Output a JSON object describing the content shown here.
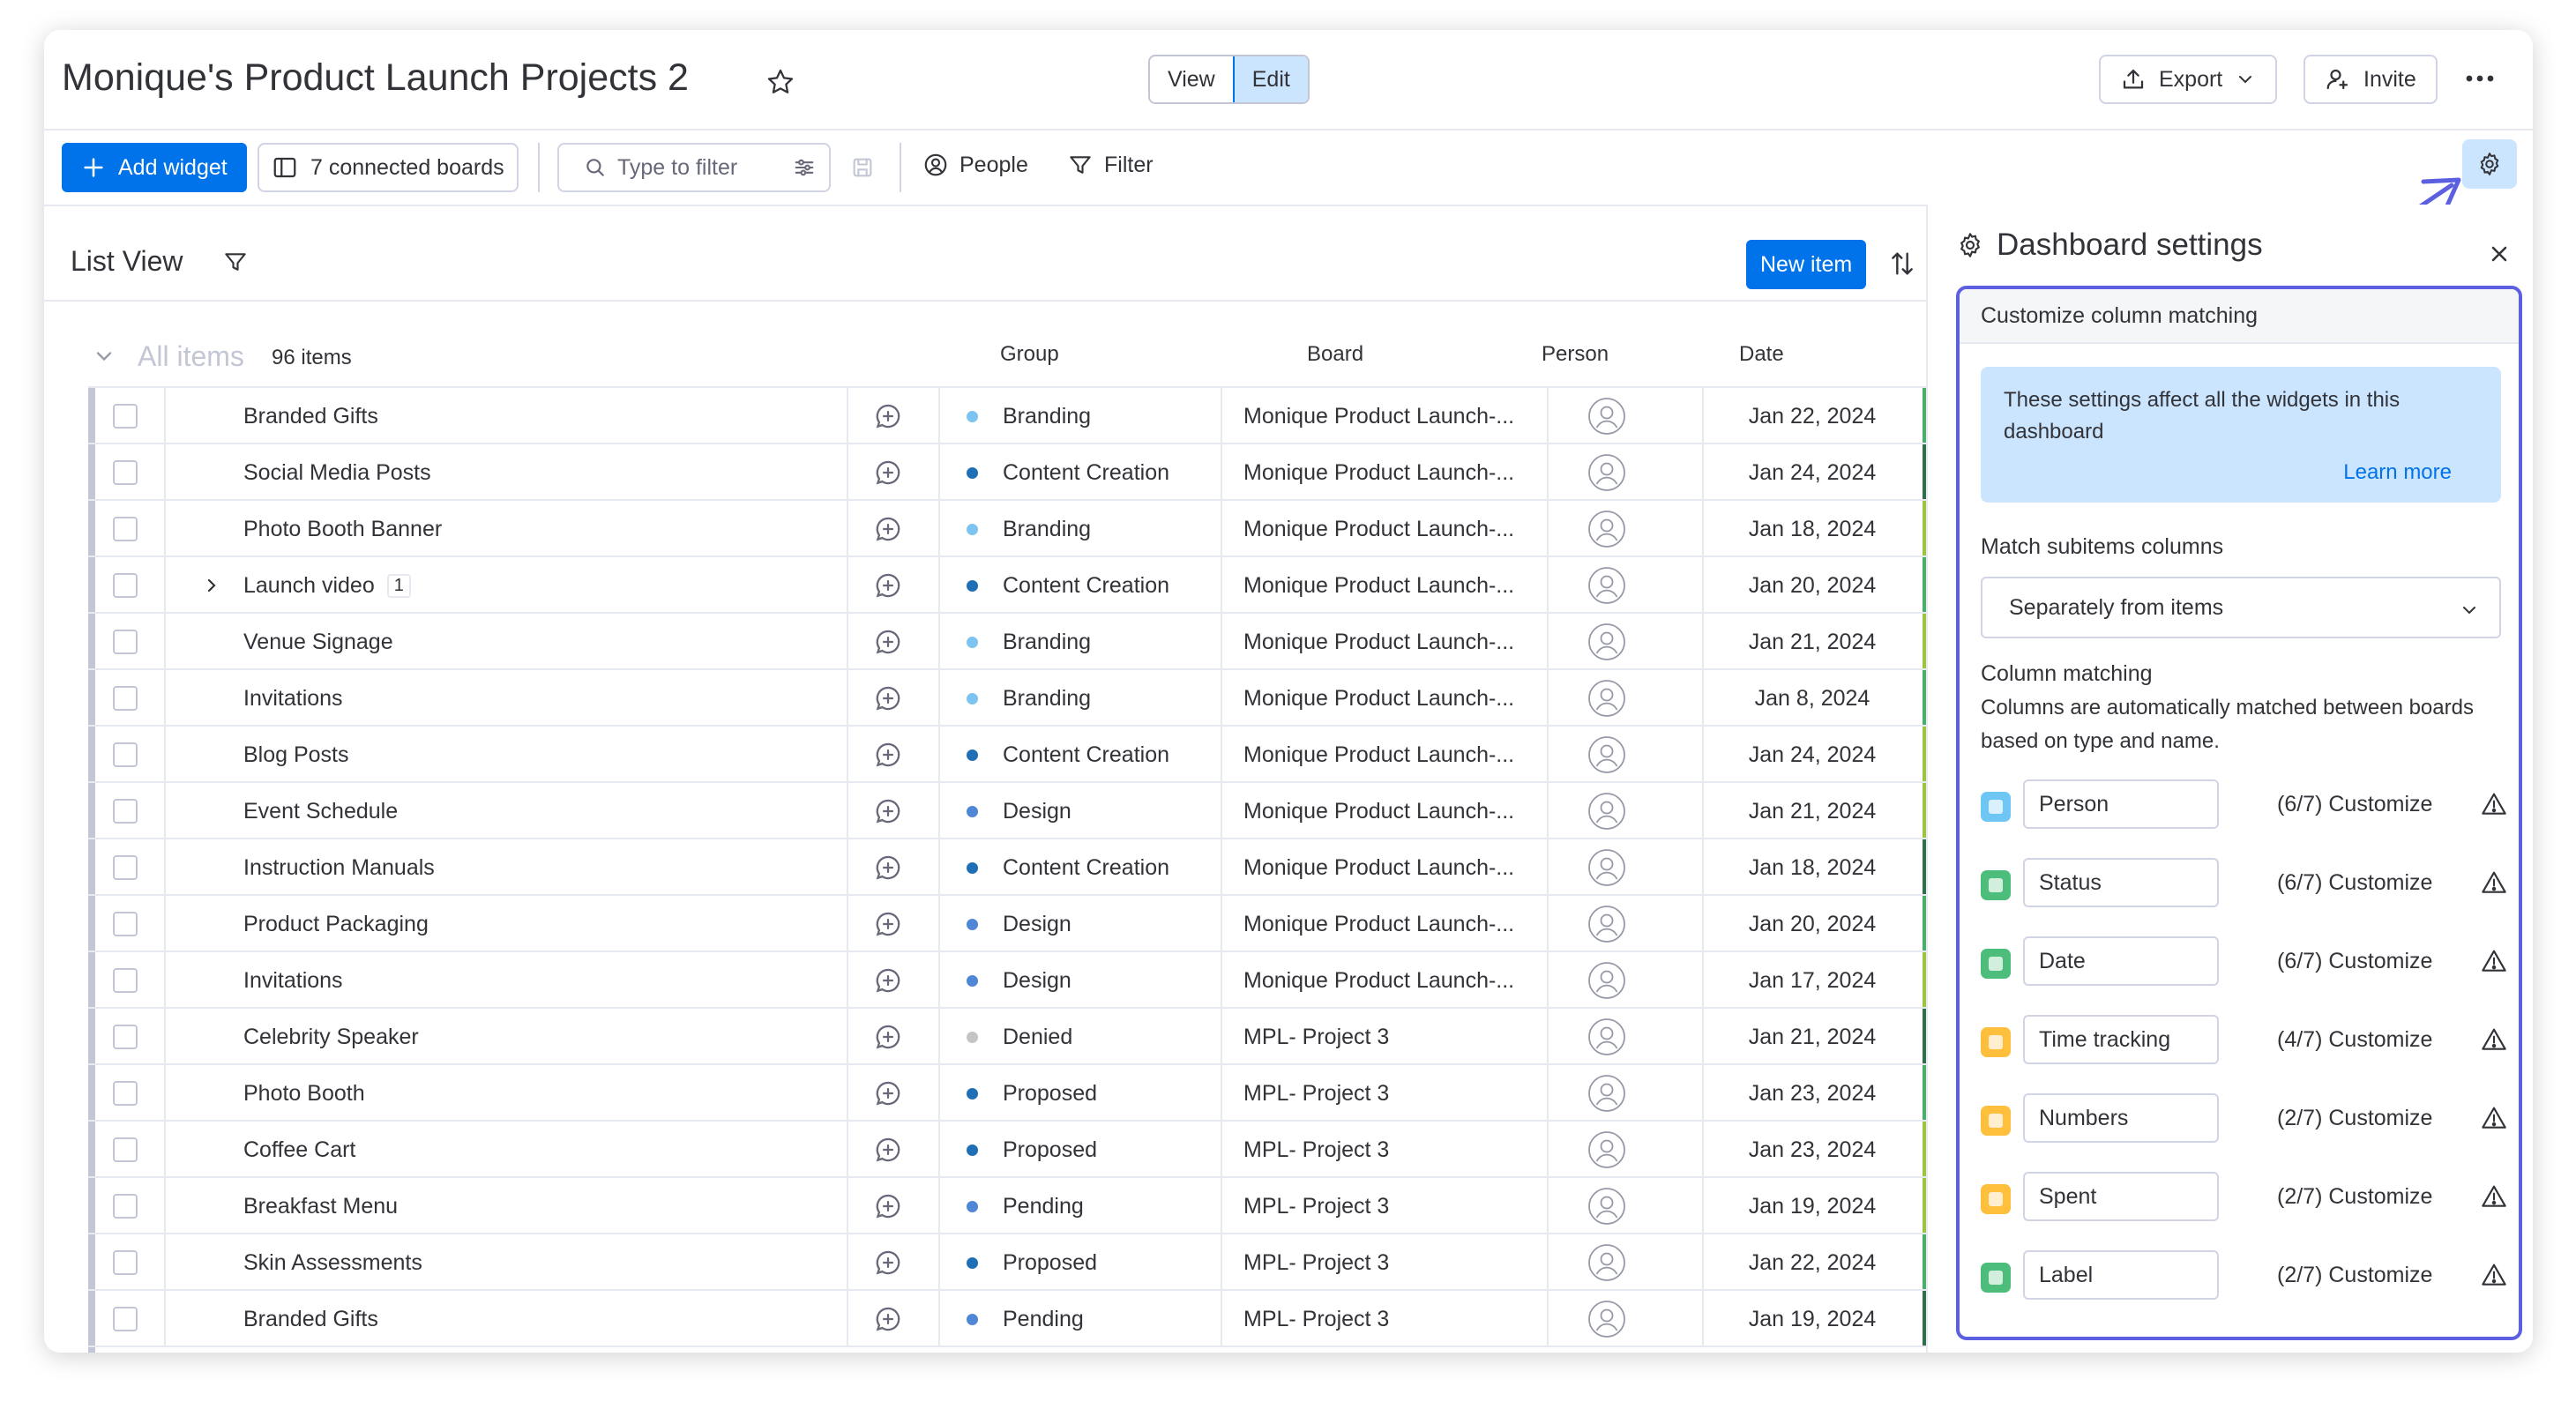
{
  "header": {
    "title": "Monique's Product Launch Projects 2",
    "view_label": "View",
    "edit_label": "Edit",
    "export_label": "Export",
    "invite_label": "Invite"
  },
  "toolbar": {
    "add_widget": "Add widget",
    "connected_boards": "7 connected boards",
    "filter_placeholder": "Type to filter",
    "people": "People",
    "filter": "Filter"
  },
  "list": {
    "title": "List View",
    "new_item": "New item",
    "group_title": "All items",
    "group_count": "96 items",
    "columns": [
      "Group",
      "Board",
      "Person",
      "Date"
    ],
    "rows": [
      {
        "name": "Branded Gifts",
        "group": "Branding",
        "dot": "#7dc4f0",
        "board": "Monique Product Launch-...",
        "date": "Jan 22, 2024",
        "strip": "#4cae6b"
      },
      {
        "name": "Social Media Posts",
        "group": "Content Creation",
        "dot": "#1f6fb5",
        "board": "Monique Product Launch-...",
        "date": "Jan 24, 2024",
        "strip": "#2f6f49"
      },
      {
        "name": "Photo Booth Banner",
        "group": "Branding",
        "dot": "#7dc4f0",
        "board": "Monique Product Launch-...",
        "date": "Jan 18, 2024",
        "strip": "#9cc43f"
      },
      {
        "name": "Launch video",
        "sub_count": "1",
        "expandable": true,
        "group": "Content Creation",
        "dot": "#1f6fb5",
        "board": "Monique Product Launch-...",
        "date": "Jan 20, 2024",
        "strip": "#4cae6b"
      },
      {
        "name": "Venue Signage",
        "group": "Branding",
        "dot": "#7dc4f0",
        "board": "Monique Product Launch-...",
        "date": "Jan 21, 2024",
        "strip": "#9cc43f"
      },
      {
        "name": "Invitations",
        "group": "Branding",
        "dot": "#7dc4f0",
        "board": "Monique Product Launch-...",
        "date": "Jan 8, 2024",
        "strip": "#4cae6b"
      },
      {
        "name": "Blog Posts",
        "group": "Content Creation",
        "dot": "#1f6fb5",
        "board": "Monique Product Launch-...",
        "date": "Jan 24, 2024",
        "strip": "#9cc43f"
      },
      {
        "name": "Event Schedule",
        "group": "Design",
        "dot": "#4f86d6",
        "board": "Monique Product Launch-...",
        "date": "Jan 21, 2024",
        "strip": "#9cc43f"
      },
      {
        "name": "Instruction Manuals",
        "group": "Content Creation",
        "dot": "#1f6fb5",
        "board": "Monique Product Launch-...",
        "date": "Jan 18, 2024",
        "strip": "#2f6f49"
      },
      {
        "name": "Product Packaging",
        "group": "Design",
        "dot": "#4f86d6",
        "board": "Monique Product Launch-...",
        "date": "Jan 20, 2024",
        "strip": "#4cae6b"
      },
      {
        "name": "Invitations",
        "group": "Design",
        "dot": "#4f86d6",
        "board": "Monique Product Launch-...",
        "date": "Jan 17, 2024",
        "strip": "#9cc43f"
      },
      {
        "name": "Celebrity Speaker",
        "group": "Denied",
        "dot": "#c4c4c4",
        "board": "MPL- Project 3",
        "date": "Jan 21, 2024",
        "strip": "#2f6f49"
      },
      {
        "name": "Photo Booth",
        "group": "Proposed",
        "dot": "#1f6fb5",
        "board": "MPL- Project 3",
        "date": "Jan 23, 2024",
        "strip": "#4cae6b"
      },
      {
        "name": "Coffee Cart",
        "group": "Proposed",
        "dot": "#1f6fb5",
        "board": "MPL- Project 3",
        "date": "Jan 23, 2024",
        "strip": "#9cc43f"
      },
      {
        "name": "Breakfast Menu",
        "group": "Pending",
        "dot": "#4f86d6",
        "board": "MPL- Project 3",
        "date": "Jan 19, 2024",
        "strip": "#9cc43f"
      },
      {
        "name": "Skin Assessments",
        "group": "Proposed",
        "dot": "#1f6fb5",
        "board": "MPL- Project 3",
        "date": "Jan 22, 2024",
        "strip": "#4cae6b"
      },
      {
        "name": "Branded Gifts",
        "group": "Pending",
        "dot": "#4f86d6",
        "board": "MPL- Project 3",
        "date": "Jan 19, 2024",
        "strip": "#2f6f49"
      }
    ]
  },
  "settings": {
    "title": "Dashboard settings",
    "section": "Customize column matching",
    "info_text": "These settings affect all the widgets in this dashboard",
    "learn_more": "Learn more",
    "match_subitems_label": "Match subitems columns",
    "match_subitems_value": "Separately from items",
    "column_matching_label": "Column matching",
    "column_matching_desc": "Columns are automatically matched between boards based on type and name.",
    "customize_label": "Customize",
    "columns": [
      {
        "name": "Person",
        "count": "(6/7)",
        "color": "#6ec6f5"
      },
      {
        "name": "Status",
        "count": "(6/7)",
        "color": "#4cbd7a"
      },
      {
        "name": "Date",
        "count": "(6/7)",
        "color": "#4cbd7a"
      },
      {
        "name": "Time tracking",
        "count": "(4/7)",
        "color": "#fdbf3c"
      },
      {
        "name": "Numbers",
        "count": "(2/7)",
        "color": "#fdbf3c"
      },
      {
        "name": "Spent",
        "count": "(2/7)",
        "color": "#fdbf3c"
      },
      {
        "name": "Label",
        "count": "(2/7)",
        "color": "#4cbd7a"
      }
    ]
  }
}
